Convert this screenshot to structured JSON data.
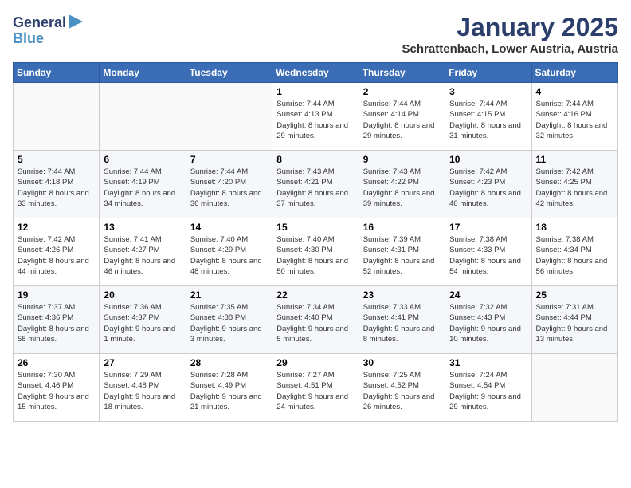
{
  "header": {
    "logo_line1": "General",
    "logo_line2": "Blue",
    "month": "January 2025",
    "location": "Schrattenbach, Lower Austria, Austria"
  },
  "weekdays": [
    "Sunday",
    "Monday",
    "Tuesday",
    "Wednesday",
    "Thursday",
    "Friday",
    "Saturday"
  ],
  "weeks": [
    [
      {
        "day": "",
        "info": ""
      },
      {
        "day": "",
        "info": ""
      },
      {
        "day": "",
        "info": ""
      },
      {
        "day": "1",
        "info": "Sunrise: 7:44 AM\nSunset: 4:13 PM\nDaylight: 8 hours and 29 minutes."
      },
      {
        "day": "2",
        "info": "Sunrise: 7:44 AM\nSunset: 4:14 PM\nDaylight: 8 hours and 29 minutes."
      },
      {
        "day": "3",
        "info": "Sunrise: 7:44 AM\nSunset: 4:15 PM\nDaylight: 8 hours and 31 minutes."
      },
      {
        "day": "4",
        "info": "Sunrise: 7:44 AM\nSunset: 4:16 PM\nDaylight: 8 hours and 32 minutes."
      }
    ],
    [
      {
        "day": "5",
        "info": "Sunrise: 7:44 AM\nSunset: 4:18 PM\nDaylight: 8 hours and 33 minutes."
      },
      {
        "day": "6",
        "info": "Sunrise: 7:44 AM\nSunset: 4:19 PM\nDaylight: 8 hours and 34 minutes."
      },
      {
        "day": "7",
        "info": "Sunrise: 7:44 AM\nSunset: 4:20 PM\nDaylight: 8 hours and 36 minutes."
      },
      {
        "day": "8",
        "info": "Sunrise: 7:43 AM\nSunset: 4:21 PM\nDaylight: 8 hours and 37 minutes."
      },
      {
        "day": "9",
        "info": "Sunrise: 7:43 AM\nSunset: 4:22 PM\nDaylight: 8 hours and 39 minutes."
      },
      {
        "day": "10",
        "info": "Sunrise: 7:42 AM\nSunset: 4:23 PM\nDaylight: 8 hours and 40 minutes."
      },
      {
        "day": "11",
        "info": "Sunrise: 7:42 AM\nSunset: 4:25 PM\nDaylight: 8 hours and 42 minutes."
      }
    ],
    [
      {
        "day": "12",
        "info": "Sunrise: 7:42 AM\nSunset: 4:26 PM\nDaylight: 8 hours and 44 minutes."
      },
      {
        "day": "13",
        "info": "Sunrise: 7:41 AM\nSunset: 4:27 PM\nDaylight: 8 hours and 46 minutes."
      },
      {
        "day": "14",
        "info": "Sunrise: 7:40 AM\nSunset: 4:29 PM\nDaylight: 8 hours and 48 minutes."
      },
      {
        "day": "15",
        "info": "Sunrise: 7:40 AM\nSunset: 4:30 PM\nDaylight: 8 hours and 50 minutes."
      },
      {
        "day": "16",
        "info": "Sunrise: 7:39 AM\nSunset: 4:31 PM\nDaylight: 8 hours and 52 minutes."
      },
      {
        "day": "17",
        "info": "Sunrise: 7:38 AM\nSunset: 4:33 PM\nDaylight: 8 hours and 54 minutes."
      },
      {
        "day": "18",
        "info": "Sunrise: 7:38 AM\nSunset: 4:34 PM\nDaylight: 8 hours and 56 minutes."
      }
    ],
    [
      {
        "day": "19",
        "info": "Sunrise: 7:37 AM\nSunset: 4:36 PM\nDaylight: 8 hours and 58 minutes."
      },
      {
        "day": "20",
        "info": "Sunrise: 7:36 AM\nSunset: 4:37 PM\nDaylight: 9 hours and 1 minute."
      },
      {
        "day": "21",
        "info": "Sunrise: 7:35 AM\nSunset: 4:38 PM\nDaylight: 9 hours and 3 minutes."
      },
      {
        "day": "22",
        "info": "Sunrise: 7:34 AM\nSunset: 4:40 PM\nDaylight: 9 hours and 5 minutes."
      },
      {
        "day": "23",
        "info": "Sunrise: 7:33 AM\nSunset: 4:41 PM\nDaylight: 9 hours and 8 minutes."
      },
      {
        "day": "24",
        "info": "Sunrise: 7:32 AM\nSunset: 4:43 PM\nDaylight: 9 hours and 10 minutes."
      },
      {
        "day": "25",
        "info": "Sunrise: 7:31 AM\nSunset: 4:44 PM\nDaylight: 9 hours and 13 minutes."
      }
    ],
    [
      {
        "day": "26",
        "info": "Sunrise: 7:30 AM\nSunset: 4:46 PM\nDaylight: 9 hours and 15 minutes."
      },
      {
        "day": "27",
        "info": "Sunrise: 7:29 AM\nSunset: 4:48 PM\nDaylight: 9 hours and 18 minutes."
      },
      {
        "day": "28",
        "info": "Sunrise: 7:28 AM\nSunset: 4:49 PM\nDaylight: 9 hours and 21 minutes."
      },
      {
        "day": "29",
        "info": "Sunrise: 7:27 AM\nSunset: 4:51 PM\nDaylight: 9 hours and 24 minutes."
      },
      {
        "day": "30",
        "info": "Sunrise: 7:25 AM\nSunset: 4:52 PM\nDaylight: 9 hours and 26 minutes."
      },
      {
        "day": "31",
        "info": "Sunrise: 7:24 AM\nSunset: 4:54 PM\nDaylight: 9 hours and 29 minutes."
      },
      {
        "day": "",
        "info": ""
      }
    ]
  ]
}
